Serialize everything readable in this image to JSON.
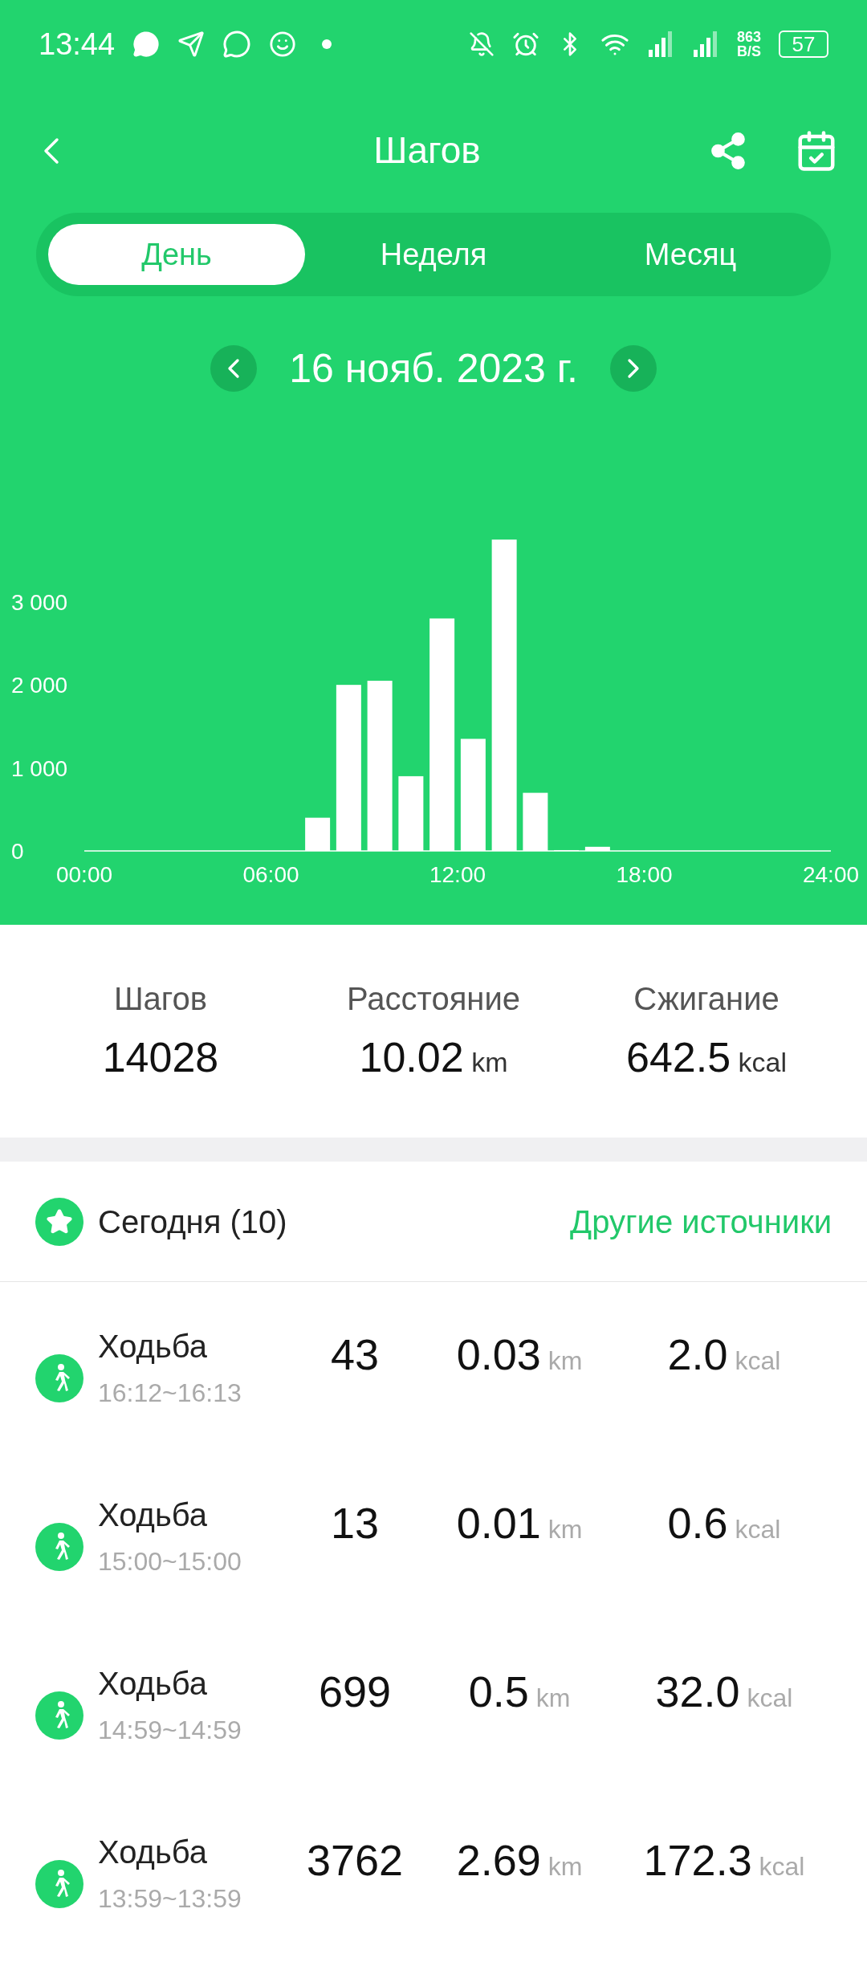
{
  "status_bar": {
    "time": "13:44",
    "net_speed": "863",
    "net_unit": "B/S",
    "battery": "57"
  },
  "header": {
    "title": "Шагов"
  },
  "tabs": [
    {
      "label": "День",
      "selected": true
    },
    {
      "label": "Неделя",
      "selected": false
    },
    {
      "label": "Месяц",
      "selected": false
    }
  ],
  "date": "16 нояб. 2023 г.",
  "chart_data": {
    "type": "bar",
    "x": [
      7.5,
      8.5,
      9.5,
      10.5,
      11.5,
      12.5,
      13.5,
      14.5,
      15.5,
      16.5
    ],
    "values": [
      400,
      2000,
      2050,
      900,
      2800,
      1350,
      3750,
      700,
      10,
      50
    ],
    "xlim": [
      0,
      24
    ],
    "ylim": [
      0,
      3800
    ],
    "xticks": [
      {
        "value": 0,
        "label": "00:00"
      },
      {
        "value": 6,
        "label": "06:00"
      },
      {
        "value": 12,
        "label": "12:00"
      },
      {
        "value": 18,
        "label": "18:00"
      },
      {
        "value": 24,
        "label": "24:00"
      }
    ],
    "yticks": [
      {
        "value": 0,
        "label": "0"
      },
      {
        "value": 1000,
        "label": "1 000"
      },
      {
        "value": 2000,
        "label": "2 000"
      },
      {
        "value": 3000,
        "label": "3 000"
      }
    ]
  },
  "summary": [
    {
      "label": "Шагов",
      "value": "14028"
    },
    {
      "label": "Расстояние",
      "value": "10.02",
      "unit": "km"
    },
    {
      "label": "Сжигание",
      "value": "642.5",
      "unit": "kcal"
    }
  ],
  "today": {
    "title": "Сегодня (10)",
    "link": "Другие источники"
  },
  "activities": [
    {
      "name": "Ходьба",
      "time": "16:12~16:13",
      "steps": "43",
      "distance": "0.03",
      "distance_unit": "km",
      "calories": "2.0",
      "calories_unit": "kcal"
    },
    {
      "name": "Ходьба",
      "time": "15:00~15:00",
      "steps": "13",
      "distance": "0.01",
      "distance_unit": "km",
      "calories": "0.6",
      "calories_unit": "kcal"
    },
    {
      "name": "Ходьба",
      "time": "14:59~14:59",
      "steps": "699",
      "distance": "0.5",
      "distance_unit": "km",
      "calories": "32.0",
      "calories_unit": "kcal"
    },
    {
      "name": "Ходьба",
      "time": "13:59~13:59",
      "steps": "3762",
      "distance": "2.69",
      "distance_unit": "km",
      "calories": "172.3",
      "calories_unit": "kcal"
    }
  ]
}
